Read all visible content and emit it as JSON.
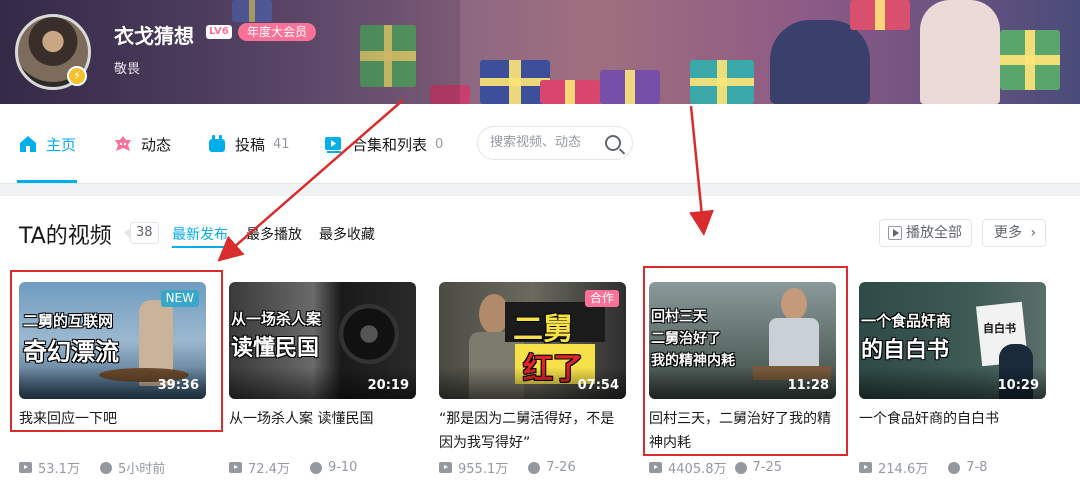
{
  "profile": {
    "username": "衣戈猜想",
    "level": "LV6",
    "vip_label": "年度大会员",
    "sign": "敬畏",
    "badge_icon": "lightning-icon"
  },
  "nav": {
    "items": [
      {
        "label": "主页",
        "count": "",
        "icon": "home-icon"
      },
      {
        "label": "动态",
        "count": "",
        "icon": "dynamic-icon"
      },
      {
        "label": "投稿",
        "count": "41",
        "icon": "upload-icon"
      },
      {
        "label": "合集和列表",
        "count": "0",
        "icon": "collection-icon"
      }
    ],
    "search_placeholder": "搜索视频、动态"
  },
  "section": {
    "title": "TA的视频",
    "count": "38",
    "sort_tabs": [
      "最新发布",
      "最多播放",
      "最多收藏"
    ],
    "play_all": "播放全部",
    "more": "更多"
  },
  "videos": [
    {
      "title": "我来回应一下吧",
      "duration": "39:36",
      "badge": "NEW",
      "thumb_text": [
        "二舅的互联网",
        "奇幻漂流"
      ],
      "views": "53.1万",
      "time": "5小时前"
    },
    {
      "title": "从一场杀人案 读懂民国",
      "duration": "20:19",
      "badge": "",
      "thumb_text": [
        "从一场杀人案",
        "读懂民国"
      ],
      "views": "72.4万",
      "time": "9-10"
    },
    {
      "title": "“那是因为二舅活得好，不是因为我写得好”",
      "duration": "07:54",
      "badge": "合作",
      "thumb_text": [
        "二舅",
        "红了"
      ],
      "views": "955.1万",
      "time": "7-26"
    },
    {
      "title": "回村三天，二舅治好了我的精神内耗",
      "duration": "11:28",
      "badge": "",
      "thumb_text": [
        "回村三天",
        "二舅治好了",
        "我的精神内耗"
      ],
      "views": "4405.8万",
      "time": "7-25"
    },
    {
      "title": "一个食品奸商的自白书",
      "duration": "10:29",
      "badge": "",
      "thumb_text": [
        "一个食品奸商",
        "的自白书",
        "自白书"
      ],
      "views": "214.6万",
      "time": "7-8"
    }
  ],
  "colors": {
    "accent": "#00aeec",
    "vip_pink": "#fb7299",
    "annotation_red": "#d92c2c"
  }
}
